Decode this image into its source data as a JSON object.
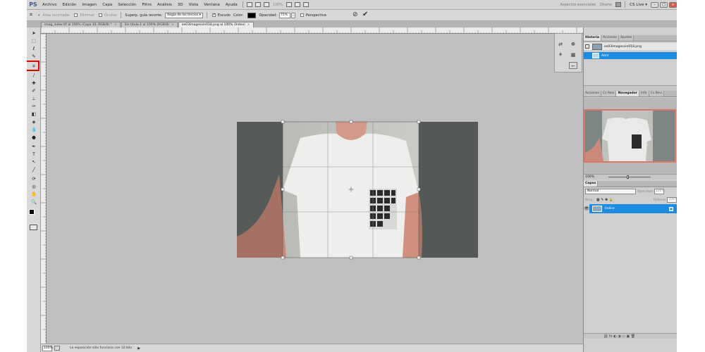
{
  "menu": {
    "logo": "PS",
    "items": [
      "Archivo",
      "Edición",
      "Imagen",
      "Capa",
      "Selección",
      "Filtro",
      "Análisis",
      "3D",
      "Vista",
      "Ventana",
      "Ayuda"
    ],
    "zoom": "100%",
    "workspace_essentials": "Aspectos esenciales",
    "workspace_design": "Diseño",
    "cs_live": "CS Live ▾"
  },
  "options": {
    "delete_cropped": "Área recortada:",
    "delete_label": "Eliminar",
    "hide_label": "Ocultar",
    "guide_label": "Superp. guía recorte:",
    "guide_value": "Regla de los tercios",
    "shield_label": "Escudo",
    "color_label": "Color:",
    "opacity_label": "Opacidad:",
    "opacity_value": "75%",
    "perspective_label": "Perspectiva",
    "shield_color": "#000000"
  },
  "tabs": [
    {
      "label": "imag_index.tif al 100% (Capa 10, RGB/8) *",
      "active": false
    },
    {
      "label": "Sin título-1 al 100% (RGB/8)",
      "active": false
    },
    {
      "label": "ee03imagesvin018.png al 100% (Índex)",
      "active": true
    }
  ],
  "status": {
    "zoom": "100%",
    "message": "La exposición sólo funciona con 32 bits"
  },
  "panels": {
    "history_tabs": [
      "Historia",
      "Acciones",
      "Ajustes"
    ],
    "history_snapshot": "ee03imagesvin018.png",
    "history_open": "Abrir",
    "nav_tabs": [
      "Acciones",
      "Cs Revi",
      "Navegador",
      "Info",
      "Cs Revi"
    ],
    "nav_zoom": "100%",
    "layers_tab": "Capas",
    "blend_mode": "Normal",
    "opacity_label": "Opacidad:",
    "opacity_value": "100%",
    "lock_label": "Bloq.:",
    "fill_label": "Relleno:",
    "fill_value": "100%",
    "layer_name": "Índice"
  },
  "colors": {
    "accent_selection": "#1c8be0",
    "highlight_border": "#e10000",
    "nav_viewbox": "#e8604c",
    "canvas_bg": "#c0c0c0"
  }
}
